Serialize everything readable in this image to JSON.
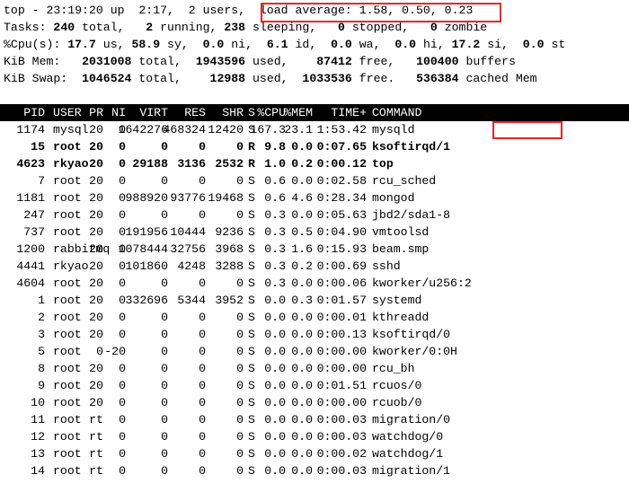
{
  "summary": [
    [
      {
        "t": "top - 23:19:20 up  2:17,  2 users,  load average: 1.58, 0.50, 0.23"
      }
    ],
    [
      {
        "t": "Tasks: "
      },
      {
        "t": "240",
        "b": 1
      },
      {
        "t": " total,   "
      },
      {
        "t": "2",
        "b": 1
      },
      {
        "t": " running, "
      },
      {
        "t": "238",
        "b": 1
      },
      {
        "t": " sleeping,   "
      },
      {
        "t": "0",
        "b": 1
      },
      {
        "t": " stopped,   "
      },
      {
        "t": "0",
        "b": 1
      },
      {
        "t": " zombie"
      }
    ],
    [
      {
        "t": "%Cpu(s): "
      },
      {
        "t": "17.7",
        "b": 1
      },
      {
        "t": " us, "
      },
      {
        "t": "58.9",
        "b": 1
      },
      {
        "t": " sy,  "
      },
      {
        "t": "0.0",
        "b": 1
      },
      {
        "t": " ni,  "
      },
      {
        "t": "6.1",
        "b": 1
      },
      {
        "t": " id,  "
      },
      {
        "t": "0.0",
        "b": 1
      },
      {
        "t": " wa,  "
      },
      {
        "t": "0.0",
        "b": 1
      },
      {
        "t": " hi, "
      },
      {
        "t": "17.2",
        "b": 1
      },
      {
        "t": " si,  "
      },
      {
        "t": "0.0",
        "b": 1
      },
      {
        "t": " st"
      }
    ],
    [
      {
        "t": "KiB Mem:   "
      },
      {
        "t": "2031008",
        "b": 1
      },
      {
        "t": " total,  "
      },
      {
        "t": "1943596",
        "b": 1
      },
      {
        "t": " used,    "
      },
      {
        "t": "87412",
        "b": 1
      },
      {
        "t": " free,   "
      },
      {
        "t": "100400",
        "b": 1
      },
      {
        "t": " buffers"
      }
    ],
    [
      {
        "t": "KiB Swap:  "
      },
      {
        "t": "1046524",
        "b": 1
      },
      {
        "t": " total,    "
      },
      {
        "t": "12988",
        "b": 1
      },
      {
        "t": " used,  "
      },
      {
        "t": "1033536",
        "b": 1
      },
      {
        "t": " free.   "
      },
      {
        "t": "536384",
        "b": 1
      },
      {
        "t": " cached Mem"
      }
    ]
  ],
  "highlight_color": "#e8262b",
  "columns": [
    "PID",
    "USER",
    "PR",
    "NI",
    "VIRT",
    "RES",
    "SHR",
    "S",
    "%CPU",
    "%MEM",
    "TIME+",
    "COMMAND"
  ],
  "processes": [
    {
      "cells": [
        "1174",
        "mysql",
        "20",
        "0",
        "1642276",
        "468324",
        "12420",
        "S",
        "167.3",
        "23.1",
        "1:53.42",
        "mysqld"
      ],
      "bold": false
    },
    {
      "cells": [
        "15",
        "root",
        "20",
        "0",
        "0",
        "0",
        "0",
        "R",
        "9.8",
        "0.0",
        "0:07.65",
        "ksoftirqd/1"
      ],
      "bold": true
    },
    {
      "cells": [
        "4623",
        "rkyao",
        "20",
        "0",
        "29188",
        "3136",
        "2532",
        "R",
        "1.0",
        "0.2",
        "0:00.12",
        "top"
      ],
      "bold": true
    },
    {
      "cells": [
        "7",
        "root",
        "20",
        "0",
        "0",
        "0",
        "0",
        "S",
        "0.6",
        "0.0",
        "0:02.58",
        "rcu_sched"
      ]
    },
    {
      "cells": [
        "1181",
        "root",
        "20",
        "0",
        "988920",
        "93776",
        "19468",
        "S",
        "0.6",
        "4.6",
        "0:28.34",
        "mongod"
      ]
    },
    {
      "cells": [
        "247",
        "root",
        "20",
        "0",
        "0",
        "0",
        "0",
        "S",
        "0.3",
        "0.0",
        "0:05.63",
        "jbd2/sda1-8"
      ]
    },
    {
      "cells": [
        "737",
        "root",
        "20",
        "0",
        "191956",
        "10444",
        "9236",
        "S",
        "0.3",
        "0.5",
        "0:04.90",
        "vmtoolsd"
      ]
    },
    {
      "cells": [
        "1200",
        "rabbitmq",
        "20",
        "0",
        "1078444",
        "32756",
        "3968",
        "S",
        "0.3",
        "1.6",
        "0:15.93",
        "beam.smp"
      ]
    },
    {
      "cells": [
        "4441",
        "rkyao",
        "20",
        "0",
        "101860",
        "4248",
        "3288",
        "S",
        "0.3",
        "0.2",
        "0:00.69",
        "sshd"
      ]
    },
    {
      "cells": [
        "4604",
        "root",
        "20",
        "0",
        "0",
        "0",
        "0",
        "S",
        "0.3",
        "0.0",
        "0:00.06",
        "kworker/u256:2"
      ]
    },
    {
      "cells": [
        "1",
        "root",
        "20",
        "0",
        "332696",
        "5344",
        "3952",
        "S",
        "0.0",
        "0.3",
        "0:01.57",
        "systemd"
      ]
    },
    {
      "cells": [
        "2",
        "root",
        "20",
        "0",
        "0",
        "0",
        "0",
        "S",
        "0.0",
        "0.0",
        "0:00.01",
        "kthreadd"
      ]
    },
    {
      "cells": [
        "3",
        "root",
        "20",
        "0",
        "0",
        "0",
        "0",
        "S",
        "0.0",
        "0.0",
        "0:00.13",
        "ksoftirqd/0"
      ]
    },
    {
      "cells": [
        "5",
        "root",
        "0",
        "-20",
        "0",
        "0",
        "0",
        "S",
        "0.0",
        "0.0",
        "0:00.00",
        "kworker/0:0H"
      ]
    },
    {
      "cells": [
        "8",
        "root",
        "20",
        "0",
        "0",
        "0",
        "0",
        "S",
        "0.0",
        "0.0",
        "0:00.00",
        "rcu_bh"
      ]
    },
    {
      "cells": [
        "9",
        "root",
        "20",
        "0",
        "0",
        "0",
        "0",
        "S",
        "0.0",
        "0.0",
        "0:01.51",
        "rcuos/0"
      ]
    },
    {
      "cells": [
        "10",
        "root",
        "20",
        "0",
        "0",
        "0",
        "0",
        "S",
        "0.0",
        "0.0",
        "0:00.00",
        "rcuob/0"
      ]
    },
    {
      "cells": [
        "11",
        "root",
        "rt",
        "0",
        "0",
        "0",
        "0",
        "S",
        "0.0",
        "0.0",
        "0:00.03",
        "migration/0"
      ]
    },
    {
      "cells": [
        "12",
        "root",
        "rt",
        "0",
        "0",
        "0",
        "0",
        "S",
        "0.0",
        "0.0",
        "0:00.03",
        "watchdog/0"
      ]
    },
    {
      "cells": [
        "13",
        "root",
        "rt",
        "0",
        "0",
        "0",
        "0",
        "S",
        "0.0",
        "0.0",
        "0:00.02",
        "watchdog/1"
      ]
    },
    {
      "cells": [
        "14",
        "root",
        "rt",
        "0",
        "0",
        "0",
        "0",
        "S",
        "0.0",
        "0.0",
        "0:00.03",
        "migration/1"
      ]
    }
  ]
}
